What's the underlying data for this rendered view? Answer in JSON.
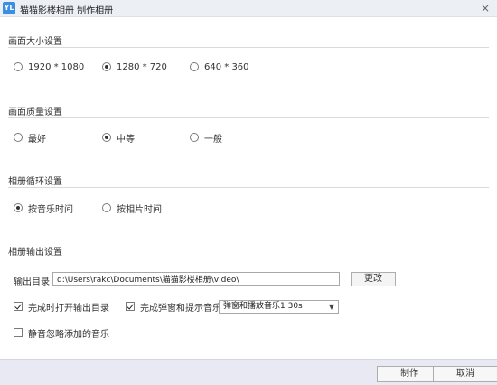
{
  "window": {
    "logo": "YL",
    "title": "猫猫影楼相册 制作相册",
    "close_glyph": "×"
  },
  "size": {
    "title": "画面大小设置",
    "options": [
      "1920 * 1080",
      "1280 * 720",
      "640 * 360"
    ],
    "selected": "1280 * 720"
  },
  "quality": {
    "title": "画面质量设置",
    "options": [
      "最好",
      "中等",
      "一般"
    ],
    "selected": "中等"
  },
  "loop": {
    "title": "相册循环设置",
    "options": [
      "按音乐时间",
      "按相片时间"
    ],
    "selected": "按音乐时间"
  },
  "output": {
    "title": "相册输出设置",
    "dir_label": "输出目录",
    "dir_value": "d:\\Users\\rakc\\Documents\\猫猫影楼相册\\video\\",
    "change_button": "更改",
    "open_after_label": "完成时打开输出目录",
    "open_after_checked": true,
    "notify_label": "完成弹窗和提示音乐",
    "notify_checked": true,
    "notify_select_value": "弹窗和播放音乐1  30s",
    "mute_label": "静音忽略添加的音乐",
    "mute_checked": false
  },
  "footer": {
    "ok_button": "制作",
    "cancel_button": "取消"
  },
  "colors": {
    "accent": "#3a8ee6",
    "footer_bg": "#e8e9f2",
    "titlebar_bg": "#eceff4"
  },
  "icons": {
    "close": "close-icon",
    "dropdown": "chevron-down-icon",
    "logo": "app-logo"
  }
}
